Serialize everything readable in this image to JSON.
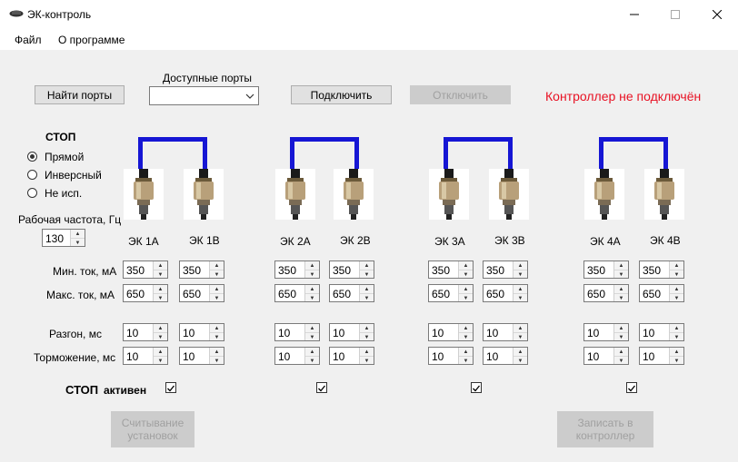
{
  "window": {
    "title": "ЭК-контроль"
  },
  "menu": {
    "file": "Файл",
    "about": "О программе"
  },
  "toolbar": {
    "find_ports": "Найти порты",
    "ports_label": "Доступные порты",
    "ports_selected": "",
    "connect": "Подключить",
    "disconnect": "Отключить",
    "status": "Контроллер не подключён"
  },
  "colors": {
    "status": "#e81123",
    "bridge": "#1616d4"
  },
  "stop": {
    "title": "СТОП",
    "options": [
      "Прямой",
      "Инверсный",
      "Не исп."
    ],
    "selected": 0,
    "freq_label": "Рабочая частота, Гц",
    "freq_value": "130",
    "active_label_1": "СТОП",
    "active_label_2": "активен"
  },
  "rows": {
    "min_current": "Мин. ток, мА",
    "max_current": "Макс. ток, мА",
    "accel": "Разгон, мс",
    "brake": "Торможение, мс"
  },
  "groups": [
    {
      "a": {
        "label": "ЭК 1А",
        "min": "350",
        "max": "650",
        "accel": "10",
        "brake": "10"
      },
      "b": {
        "label": "ЭК 1В",
        "min": "350",
        "max": "650",
        "accel": "10",
        "brake": "10"
      },
      "stop_active": true
    },
    {
      "a": {
        "label": "ЭК 2А",
        "min": "350",
        "max": "650",
        "accel": "10",
        "brake": "10"
      },
      "b": {
        "label": "ЭК 2В",
        "min": "350",
        "max": "650",
        "accel": "10",
        "brake": "10"
      },
      "stop_active": true
    },
    {
      "a": {
        "label": "ЭК 3А",
        "min": "350",
        "max": "650",
        "accel": "10",
        "brake": "10"
      },
      "b": {
        "label": "ЭК 3В",
        "min": "350",
        "max": "650",
        "accel": "10",
        "brake": "10"
      },
      "stop_active": true
    },
    {
      "a": {
        "label": "ЭК 4А",
        "min": "350",
        "max": "650",
        "accel": "10",
        "brake": "10"
      },
      "b": {
        "label": "ЭК 4В",
        "min": "350",
        "max": "650",
        "accel": "10",
        "brake": "10"
      },
      "stop_active": true
    }
  ],
  "footer": {
    "read_settings": "Считывание установок",
    "write_controller": "Записать в контроллер"
  }
}
